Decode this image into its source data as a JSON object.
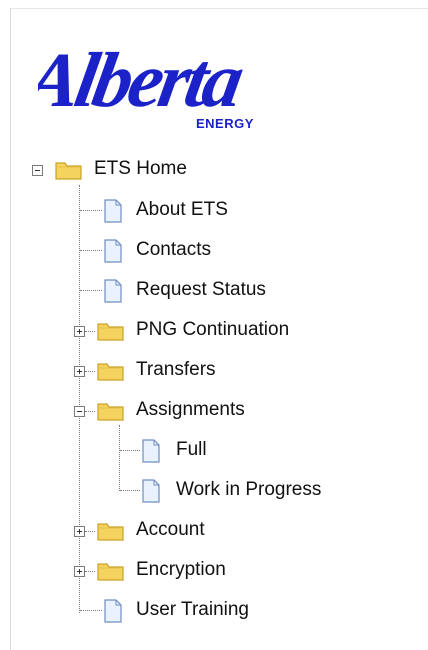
{
  "logo": {
    "brand": "Alberta",
    "subtitle": "ENERGY"
  },
  "tree": {
    "root": {
      "label": "ETS Home",
      "icon": "folder-open-icon",
      "expanded": true
    },
    "items": [
      {
        "label": "About ETS",
        "icon": "document-icon"
      },
      {
        "label": "Contacts",
        "icon": "document-icon"
      },
      {
        "label": "Request Status",
        "icon": "document-icon"
      },
      {
        "label": "PNG Continuation",
        "icon": "folder-icon",
        "expanded": false
      },
      {
        "label": "Transfers",
        "icon": "folder-icon",
        "expanded": false
      },
      {
        "label": "Assignments",
        "icon": "folder-icon",
        "expanded": true,
        "children": [
          {
            "label": "Full",
            "icon": "document-icon"
          },
          {
            "label": "Work in Progress",
            "icon": "document-icon"
          }
        ]
      },
      {
        "label": "Account",
        "icon": "folder-icon",
        "expanded": false
      },
      {
        "label": "Encryption",
        "icon": "folder-icon",
        "expanded": false
      },
      {
        "label": "User Training",
        "icon": "document-icon"
      }
    ]
  },
  "colors": {
    "brand": "#1b22c8",
    "folder": "#f4d35e",
    "folder_edge": "#c9a227",
    "doc_edge": "#6f8fbf",
    "doc_fill": "#eaf1ff"
  }
}
